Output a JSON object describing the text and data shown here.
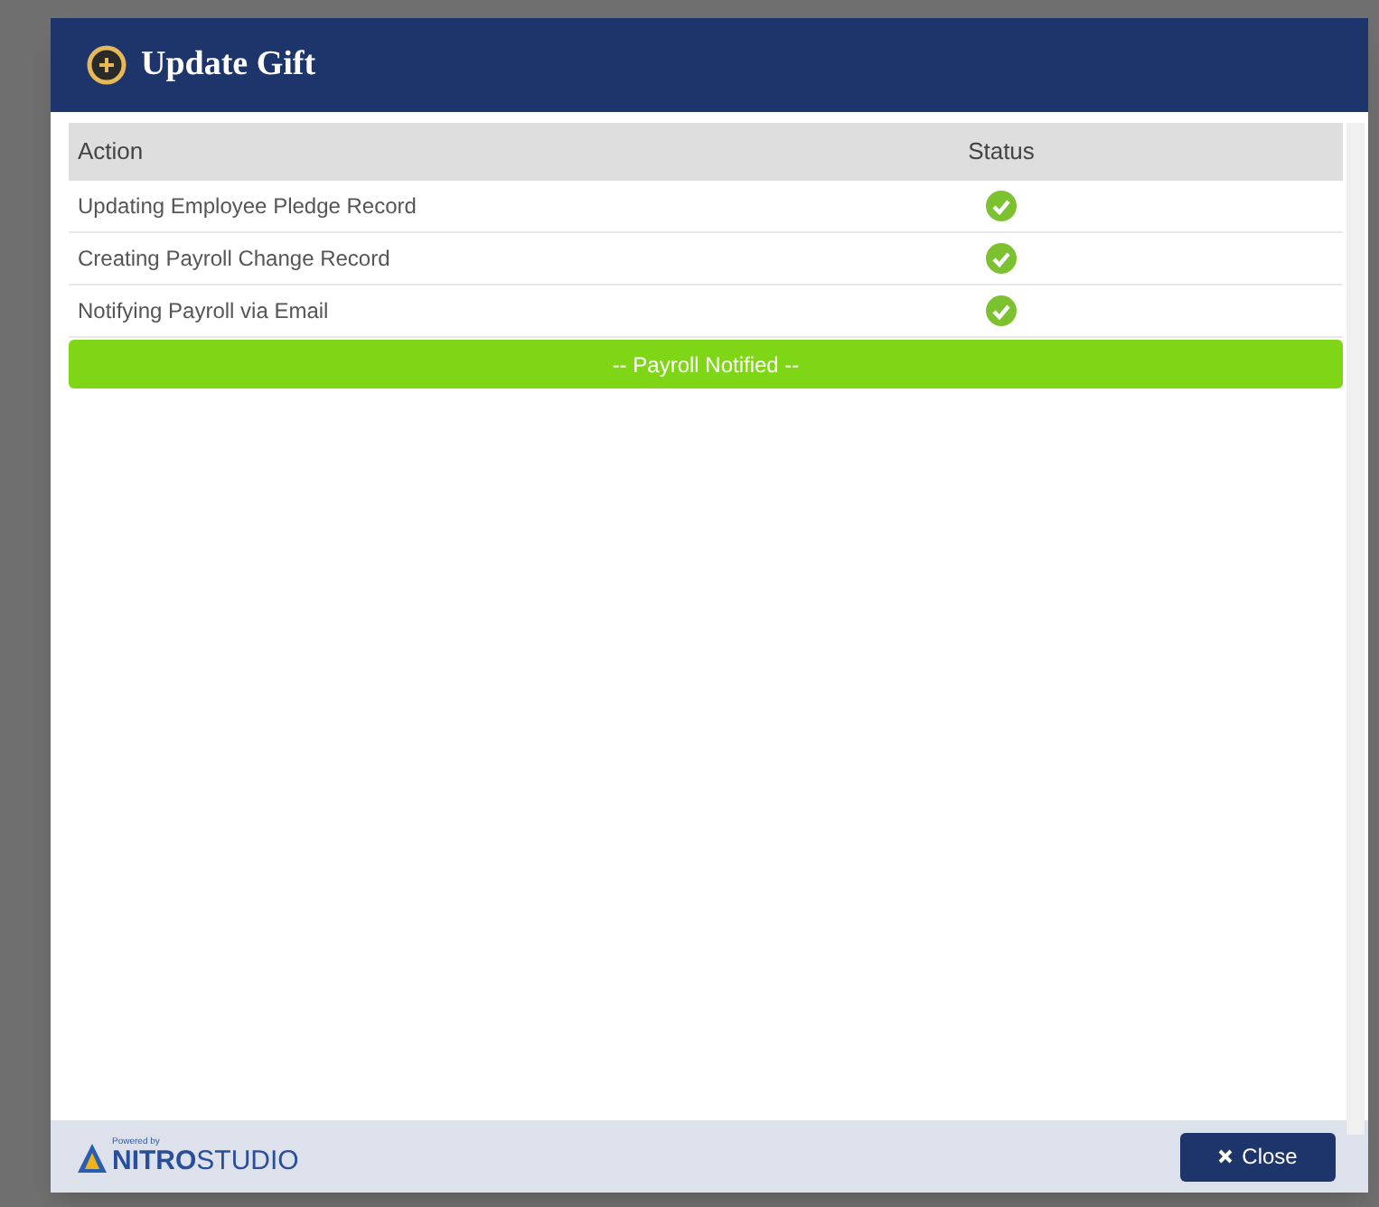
{
  "dialog": {
    "title": "Update Gift"
  },
  "table": {
    "columns": [
      "Action",
      "Status"
    ],
    "rows": [
      {
        "action": "Updating Employee Pledge Record",
        "done": true
      },
      {
        "action": "Creating Payroll Change Record",
        "done": true
      },
      {
        "action": "Notifying Payroll via Email",
        "done": true
      }
    ]
  },
  "result_banner": "-- Payroll Notified --",
  "footer": {
    "logo_tagline": "Powered by",
    "logo_brand": "NITRO",
    "logo_product": "STUDIO",
    "close_button": "Close"
  }
}
